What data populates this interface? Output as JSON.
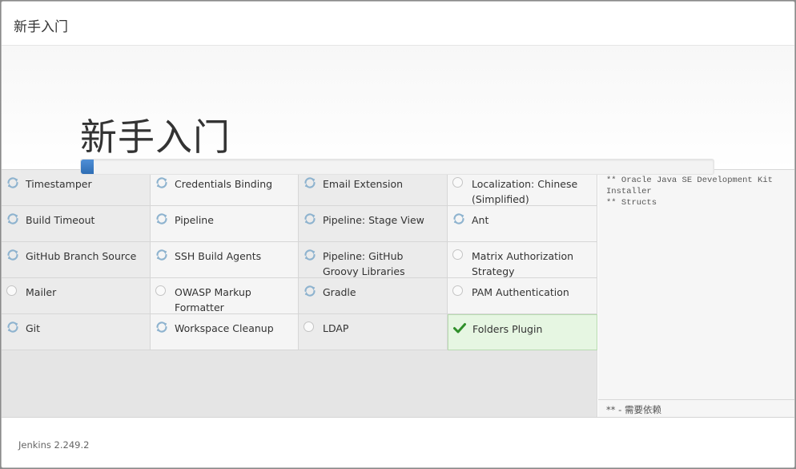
{
  "header": {
    "title": "新手入门"
  },
  "hero": {
    "title": "新手入门",
    "progress_percent": 2
  },
  "plugins": [
    [
      {
        "name": "Timestamper",
        "status": "installing"
      },
      {
        "name": "Credentials Binding",
        "status": "installing"
      },
      {
        "name": "Email Extension",
        "status": "installing"
      },
      {
        "name": "Localization: Chinese (Simplified)",
        "status": "pending"
      }
    ],
    [
      {
        "name": "Build Timeout",
        "status": "installing"
      },
      {
        "name": "Pipeline",
        "status": "installing"
      },
      {
        "name": "Pipeline: Stage View",
        "status": "installing"
      },
      {
        "name": "Ant",
        "status": "installing"
      }
    ],
    [
      {
        "name": "GitHub Branch Source",
        "status": "installing"
      },
      {
        "name": "SSH Build Agents",
        "status": "installing"
      },
      {
        "name": "Pipeline: GitHub Groovy Libraries",
        "status": "installing"
      },
      {
        "name": "Matrix Authorization Strategy",
        "status": "pending"
      }
    ],
    [
      {
        "name": "Mailer",
        "status": "pending"
      },
      {
        "name": "OWASP Markup Formatter",
        "status": "pending"
      },
      {
        "name": "Gradle",
        "status": "installing"
      },
      {
        "name": "PAM Authentication",
        "status": "pending"
      }
    ],
    [
      {
        "name": "Git",
        "status": "installing"
      },
      {
        "name": "Workspace Cleanup",
        "status": "installing"
      },
      {
        "name": "LDAP",
        "status": "pending"
      },
      {
        "name": "Folders Plugin",
        "status": "success"
      }
    ]
  ],
  "log": {
    "text": "** Oracle Java SE Development Kit Installer\n** Structs",
    "footnote": "** - 需要依赖"
  },
  "footer": {
    "version": "Jenkins 2.249.2"
  },
  "icons": {
    "installing": "refresh-icon",
    "pending": "pending-circle-icon",
    "success": "checkmark-icon"
  },
  "colors": {
    "accent": "#3a78c2",
    "success_bg": "#e6f6e2",
    "success_check": "#2f8f2a"
  }
}
